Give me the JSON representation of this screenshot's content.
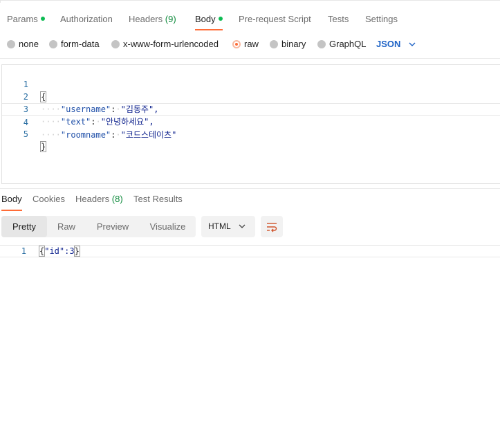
{
  "request_tabs": [
    {
      "label": "Params",
      "dot": true
    },
    {
      "label": "Authorization"
    },
    {
      "label": "Headers",
      "count": "(9)"
    },
    {
      "label": "Body",
      "dot": true,
      "active": true
    },
    {
      "label": "Pre-request Script"
    },
    {
      "label": "Tests"
    },
    {
      "label": "Settings"
    }
  ],
  "body_types": {
    "options": [
      "none",
      "form-data",
      "x-www-form-urlencoded",
      "raw",
      "binary",
      "GraphQL"
    ],
    "selected": "raw",
    "language": "JSON"
  },
  "request_body": {
    "line_numbers": [
      "1",
      "2",
      "3",
      "4",
      "5"
    ],
    "open_brace": "{",
    "close_brace": "}",
    "fields": [
      {
        "key": "\"username\"",
        "value": "\"김동주\","
      },
      {
        "key": "\"text\"",
        "value": "\"안녕하세요\","
      },
      {
        "key": "\"roomname\"",
        "value": "\"코드스테이츠\""
      }
    ]
  },
  "response_tabs": [
    {
      "label": "Body",
      "active": true
    },
    {
      "label": "Cookies"
    },
    {
      "label": "Headers",
      "count": "(8)"
    },
    {
      "label": "Test Results"
    }
  ],
  "view_modes": {
    "options": [
      "Pretty",
      "Raw",
      "Preview",
      "Visualize"
    ],
    "selected": "Pretty"
  },
  "format_select": {
    "value": "HTML"
  },
  "response_body": {
    "line_number": "1",
    "open_brace": "{",
    "content": "\"id\":3",
    "close_brace": "}"
  },
  "colors": {
    "accent": "#ff6c37",
    "dot_green": "#0cbb52",
    "link_blue": "#1e63c6"
  }
}
